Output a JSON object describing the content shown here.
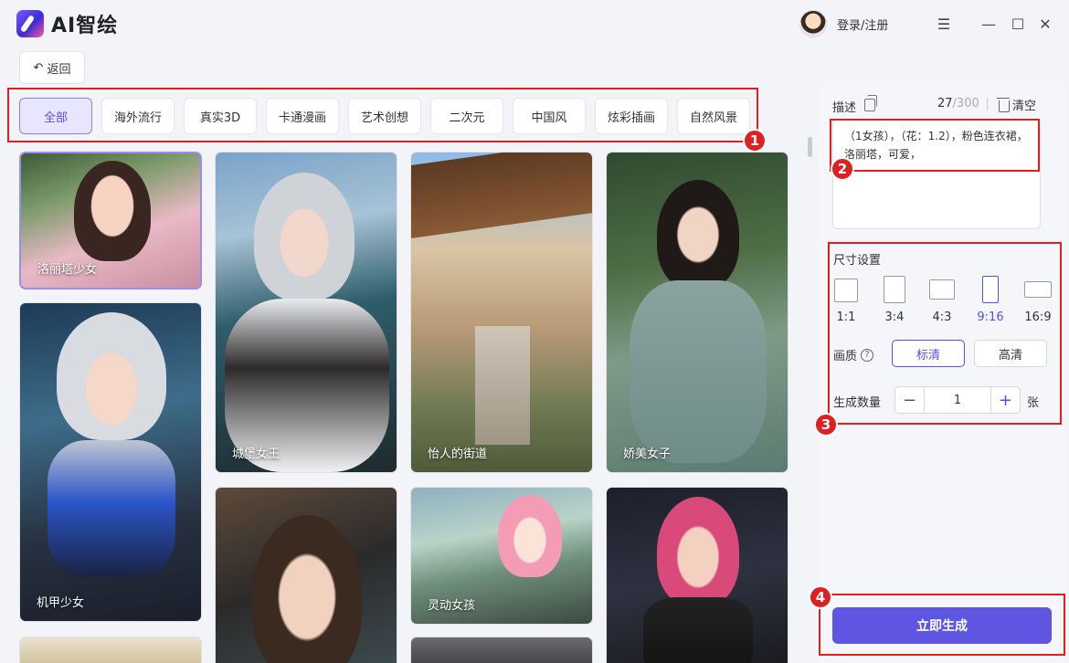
{
  "app": {
    "title": "AI智绘",
    "login": "登录/注册"
  },
  "window": {
    "menu_icon": "☰",
    "min_icon": "—",
    "max_icon": "☐",
    "close_icon": "✕"
  },
  "back": {
    "label": "返回",
    "icon": "↶"
  },
  "tabs": [
    {
      "label": "全部",
      "active": true
    },
    {
      "label": "海外流行"
    },
    {
      "label": "真实3D"
    },
    {
      "label": "卡通漫画"
    },
    {
      "label": "艺术创想"
    },
    {
      "label": "二次元"
    },
    {
      "label": "中国风"
    },
    {
      "label": "炫彩插画"
    },
    {
      "label": "自然风景"
    }
  ],
  "badges": [
    "1",
    "2",
    "3",
    "4"
  ],
  "gallery": [
    {
      "label": "洛丽塔少女"
    },
    {
      "label": "机甲少女"
    },
    {
      "label": "城堡女王"
    },
    {
      "label": "怡人的街道"
    },
    {
      "label": "灵动女孩"
    },
    {
      "label": "娇美女子"
    }
  ],
  "panel": {
    "desc_label": "描述",
    "count_current": "27",
    "count_max": "/300",
    "clear_label": "清空",
    "description": "（1女孩），（花：1.2），粉色连衣裙，洛丽塔，可爱，",
    "size_title": "尺寸设置",
    "ratios": [
      "1:1",
      "3:4",
      "4:3",
      "9:16",
      "16:9"
    ],
    "active_ratio": "9:16",
    "quality_label": "画质",
    "quality_help": "?",
    "quality_options": [
      "标清",
      "高清"
    ],
    "quantity_label": "生成数量",
    "quantity_minus": "−",
    "quantity_value": "1",
    "quantity_plus": "+",
    "quantity_unit": "张",
    "generate_label": "立即生成"
  },
  "colors": {
    "accent": "#5e56e3",
    "highlight": "#e02020",
    "active_tab_bg": "#e8e6ff"
  }
}
